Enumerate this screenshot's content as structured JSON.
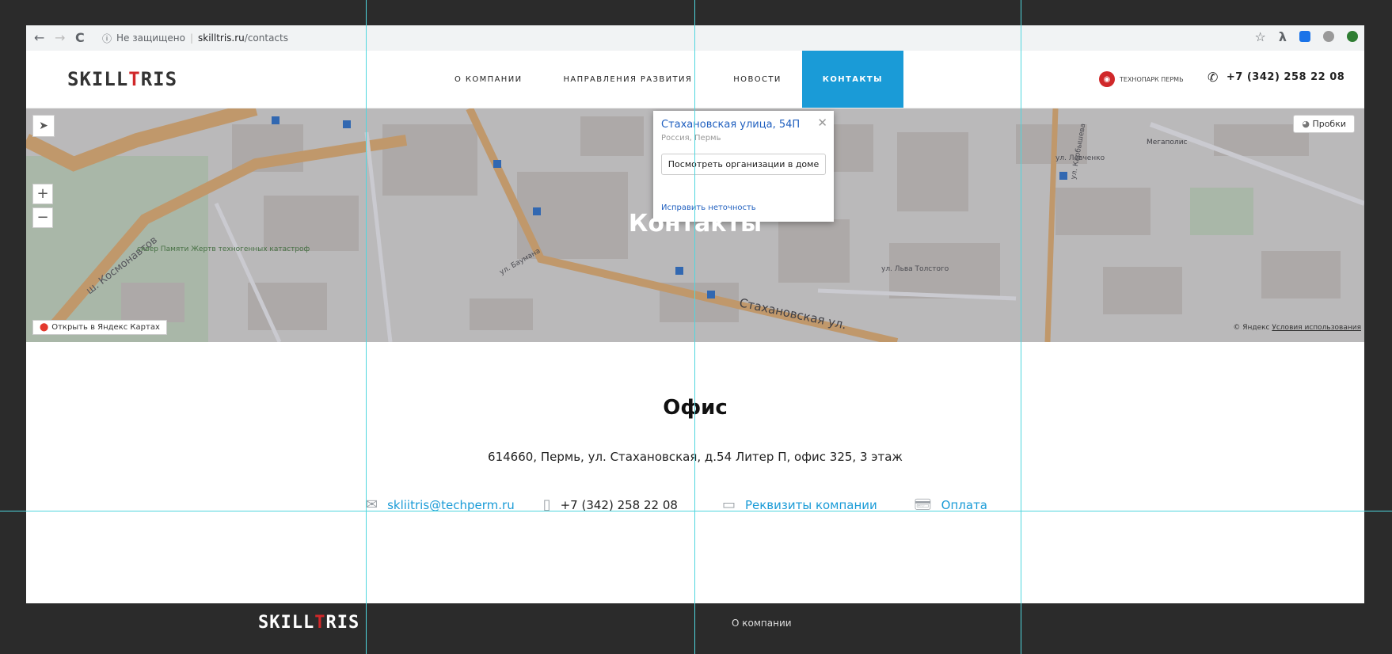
{
  "browser": {
    "back": "←",
    "forward": "→",
    "reload": "C",
    "security": "Не защищено",
    "domain": "skilltris.ru",
    "path": "/contacts",
    "star": "☆",
    "ext_colors": [
      "#1a73e8",
      "#999999",
      "#2e7d32"
    ]
  },
  "header": {
    "logo_pre": "SKILL",
    "logo_t": "T",
    "logo_post": "RIS",
    "menu": [
      {
        "label": "О КОМПАНИИ"
      },
      {
        "label": "НАПРАВЛЕНИЯ РАЗВИТИЯ"
      },
      {
        "label": "НОВОСТИ"
      },
      {
        "label": "КОНТАКТЫ"
      }
    ],
    "partner": "ТЕХНОПАРК ПЕРМЬ",
    "phone": "+7 (342) 258 22 08",
    "accent": "#1a9bd7",
    "brand_red": "#d0282a"
  },
  "map": {
    "title": "Контакты",
    "traffic": "Пробки",
    "open_in_yandex": "Открыть в Яндекс Картах",
    "legal_pre": "© Яндекс",
    "legal_link": "Условия использования",
    "zoom_in": "+",
    "zoom_out": "−",
    "street_labels": [
      "ш. Космонавтов",
      "Стахановская ул.",
      "ул. Баумана",
      "ул. Льва Толстого",
      "ул. Левченко",
      "ул. Карбышева",
      "сквер Памяти Жертв техногенных катастроф",
      "Мегаполис"
    ],
    "popup": {
      "address": "Стахановская улица, 54П",
      "city": "Россия, Пермь",
      "button": "Посмотреть организации в доме",
      "fix": "Исправить неточность"
    }
  },
  "content": {
    "office_title": "Офис",
    "address": "614660, Пермь, ул. Стахановская, д.54 Литер П, офис 325, 3 этаж",
    "email": "skliitris@techperm.ru",
    "phone": "+7 (342) 258 22 08",
    "requisites": "Реквизиты компании",
    "payment": "Оплата"
  },
  "footer": {
    "logo_pre": "SKILL",
    "logo_t": "T",
    "logo_post": "RIS",
    "link": "О компании"
  }
}
